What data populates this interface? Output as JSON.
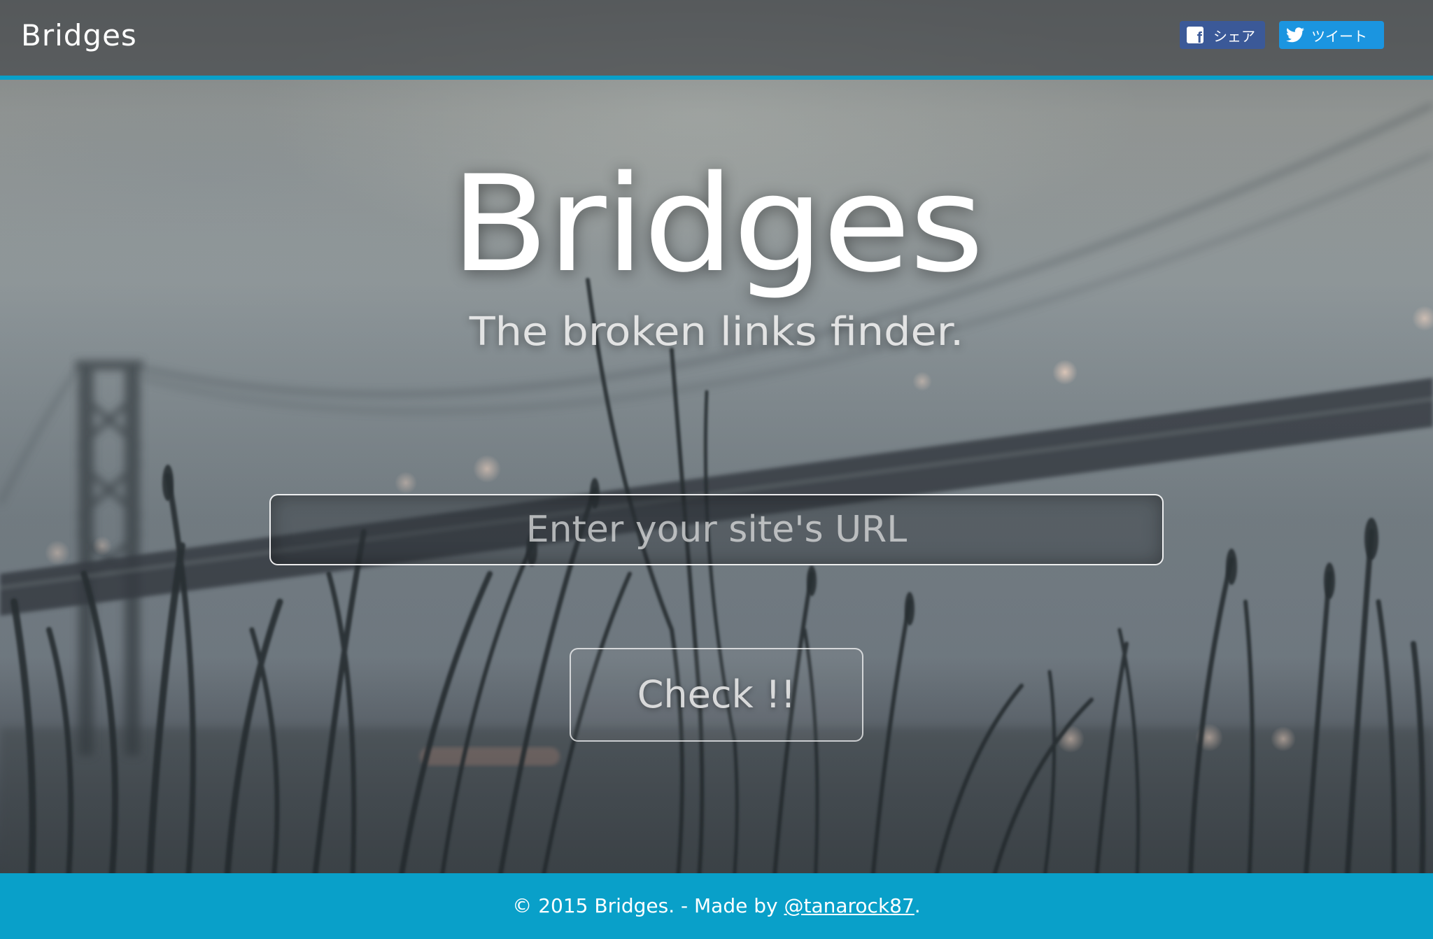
{
  "header": {
    "brand": "Bridges",
    "share_facebook_label": "シェア",
    "share_twitter_label": "ツイート"
  },
  "hero": {
    "title": "Bridges",
    "subtitle": "The broken links finder."
  },
  "form": {
    "url_placeholder": "Enter your site's URL",
    "url_value": "",
    "submit_label": "Check !!"
  },
  "footer": {
    "prefix": "© 2015 Bridges. - Made by ",
    "author_link": "@tanarock87",
    "suffix": "."
  },
  "colors": {
    "accent": "#09a0c9",
    "facebook": "#3b5998",
    "twitter": "#1b95e0"
  },
  "icons": {
    "facebook": "facebook-icon",
    "twitter": "twitter-bird-icon"
  }
}
